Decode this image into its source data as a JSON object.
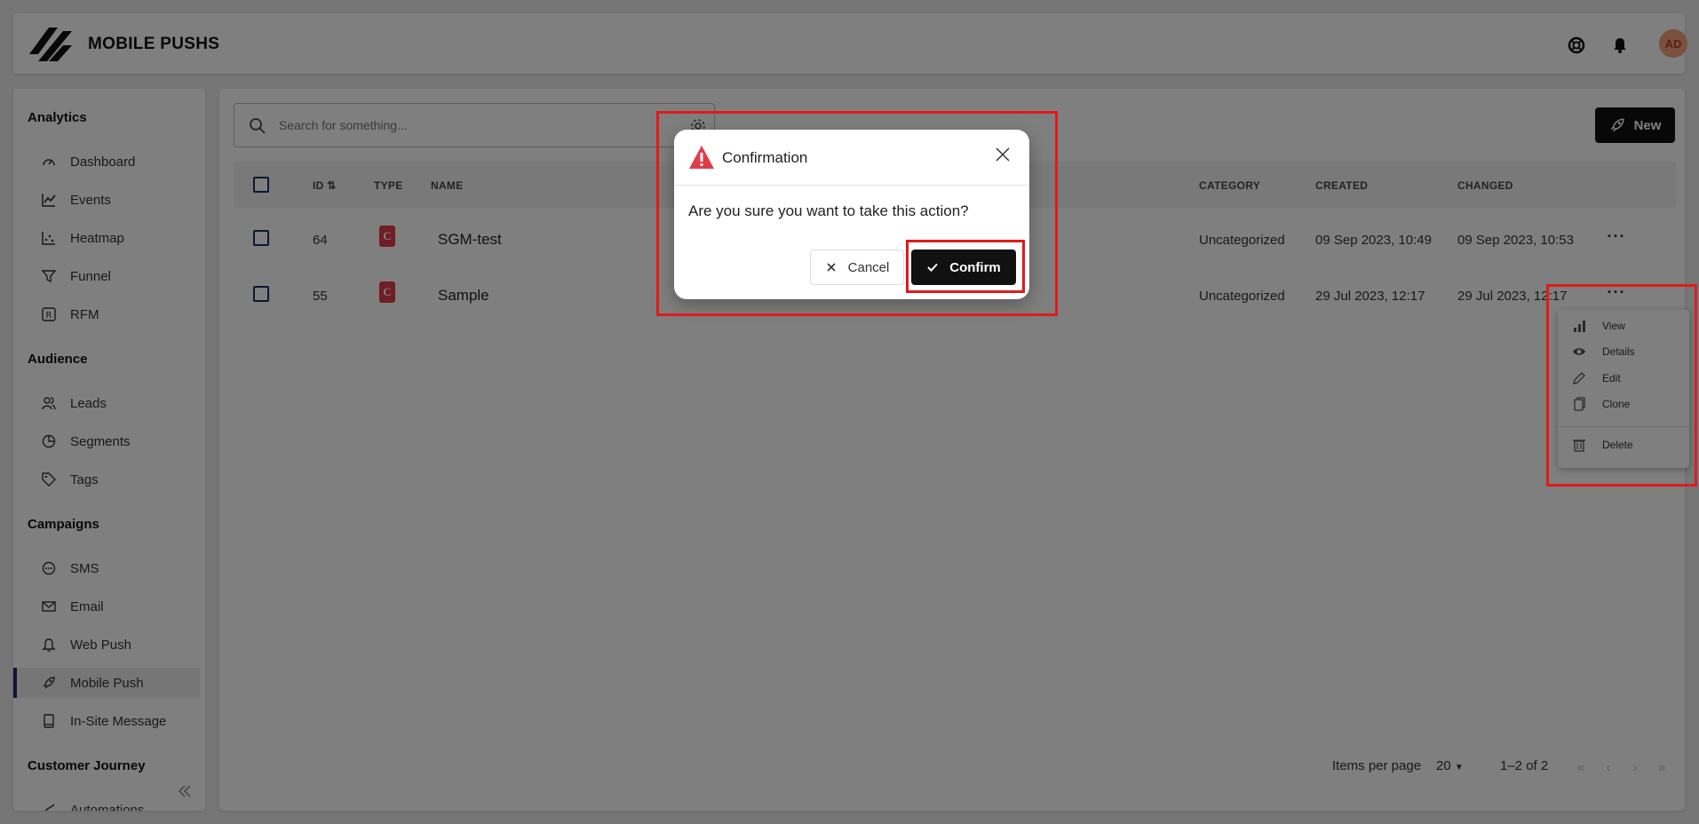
{
  "header": {
    "title": "MOBILE PUSHS",
    "icons": [
      "support-icon",
      "bell-icon"
    ],
    "avatar": "AD"
  },
  "sidebar": {
    "sections": [
      {
        "title": "Analytics",
        "items": [
          {
            "label": "Dashboard",
            "icon": "dashboard-icon"
          },
          {
            "label": "Events",
            "icon": "line-chart-icon"
          },
          {
            "label": "Heatmap",
            "icon": "scatter-chart-icon"
          },
          {
            "label": "Funnel",
            "icon": "funnel-icon"
          },
          {
            "label": "RFM",
            "icon": "rfm-icon"
          }
        ]
      },
      {
        "title": "Audience",
        "items": [
          {
            "label": "Leads",
            "icon": "users-icon"
          },
          {
            "label": "Segments",
            "icon": "pie-chart-icon"
          },
          {
            "label": "Tags",
            "icon": "tag-icon"
          }
        ]
      },
      {
        "title": "Campaigns",
        "items": [
          {
            "label": "SMS",
            "icon": "chat-icon"
          },
          {
            "label": "Email",
            "icon": "mail-icon"
          },
          {
            "label": "Web Push",
            "icon": "bell-icon"
          },
          {
            "label": "Mobile Push",
            "icon": "rocket-icon",
            "active": true
          },
          {
            "label": "In-Site Message",
            "icon": "tablet-icon"
          }
        ]
      },
      {
        "title": "Customer Journey",
        "items": [
          {
            "label": "Automations",
            "icon": "automation-icon"
          }
        ]
      }
    ]
  },
  "search": {
    "placeholder": "Search for something..."
  },
  "toolbar": {
    "new_label": "New"
  },
  "table": {
    "columns": [
      "ID",
      "TYPE",
      "NAME",
      "CATEGORY",
      "CREATED",
      "CHANGED"
    ],
    "rows": [
      {
        "id": "64",
        "type": "C",
        "name": "SGM-test",
        "category": "Uncategorized",
        "created": "09 Sep 2023, 10:49",
        "changed": "09 Sep 2023, 10:53"
      },
      {
        "id": "55",
        "type": "C",
        "name": "Sample",
        "category": "Uncategorized",
        "created": "29 Jul 2023, 12:17",
        "changed": "29 Jul 2023, 12:17"
      }
    ]
  },
  "pagination": {
    "items_per_page_label": "Items per page",
    "page_size": "20",
    "range": "1–2 of 2"
  },
  "context_menu": {
    "items": [
      {
        "label": "View",
        "icon": "bar-chart-icon"
      },
      {
        "label": "Details",
        "icon": "eye-icon"
      },
      {
        "label": "Edit",
        "icon": "pencil-icon"
      },
      {
        "label": "Clone",
        "icon": "copy-icon"
      },
      {
        "label": "Delete",
        "icon": "trash-icon"
      }
    ]
  },
  "dialog": {
    "title": "Confirmation",
    "message": "Are you sure you want to take this action?",
    "cancel_label": "Cancel",
    "confirm_label": "Confirm"
  },
  "colors": {
    "accent": "#1c2d6b",
    "warning": "#e23b4a",
    "annotation": "#e01b1b"
  }
}
